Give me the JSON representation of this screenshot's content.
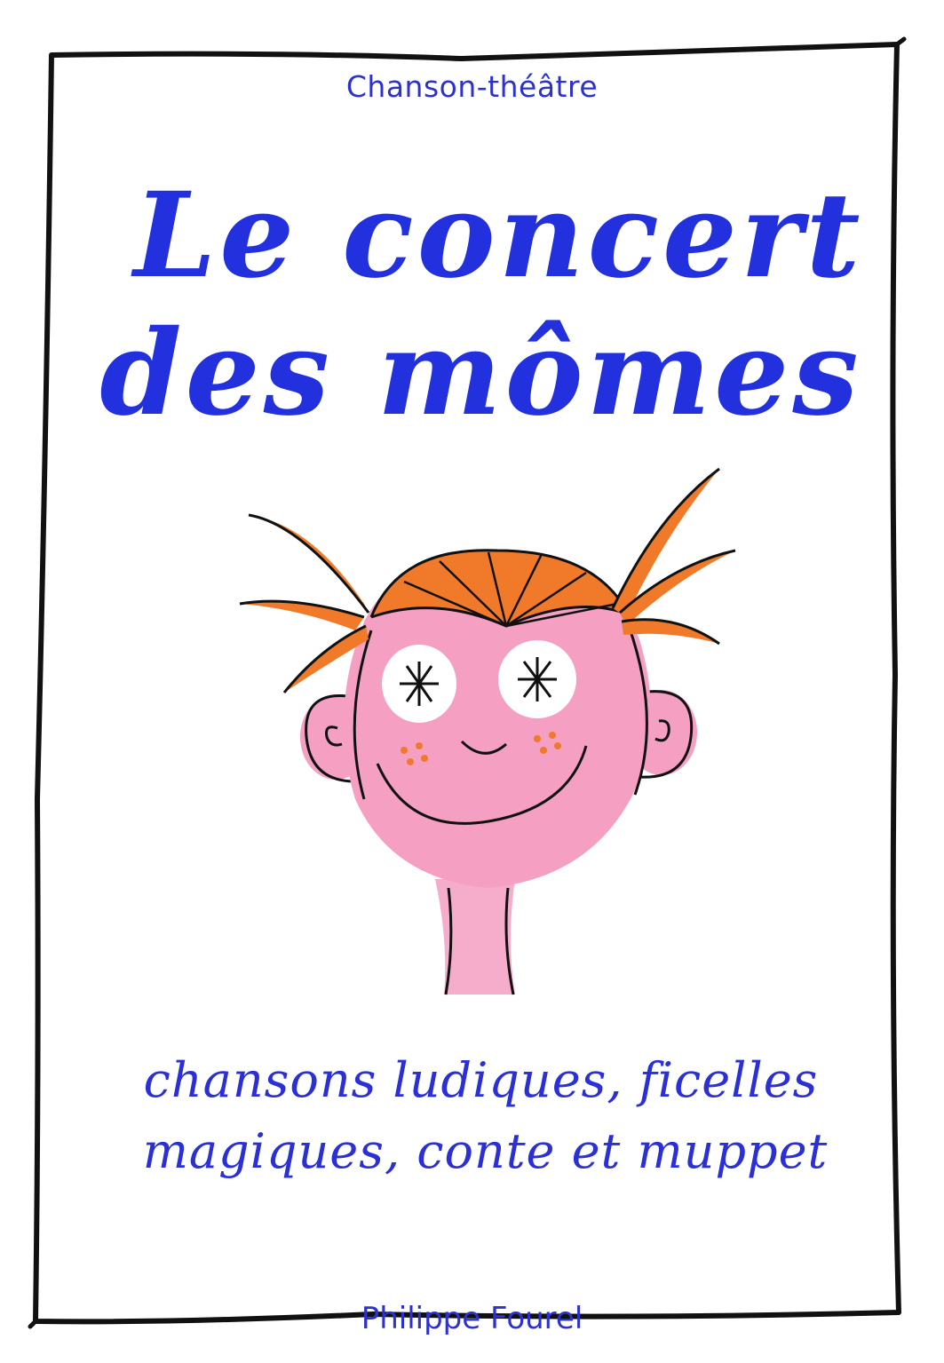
{
  "poster": {
    "genre": "Chanson-théâtre",
    "title_line1": "Le concert",
    "title_line2": "des mômes",
    "tagline_line1": "chansons ludiques, ficelles",
    "tagline_line2": "magiques, conte et muppet",
    "author": "Philippe Fourel"
  },
  "colors": {
    "text_blue": "#2a2fd6",
    "face_pink": "#f59fc3",
    "hair_orange": "#f07a2a",
    "frame_black": "#111111"
  },
  "illustration": {
    "subject": "cartoon-child-face-icon"
  }
}
